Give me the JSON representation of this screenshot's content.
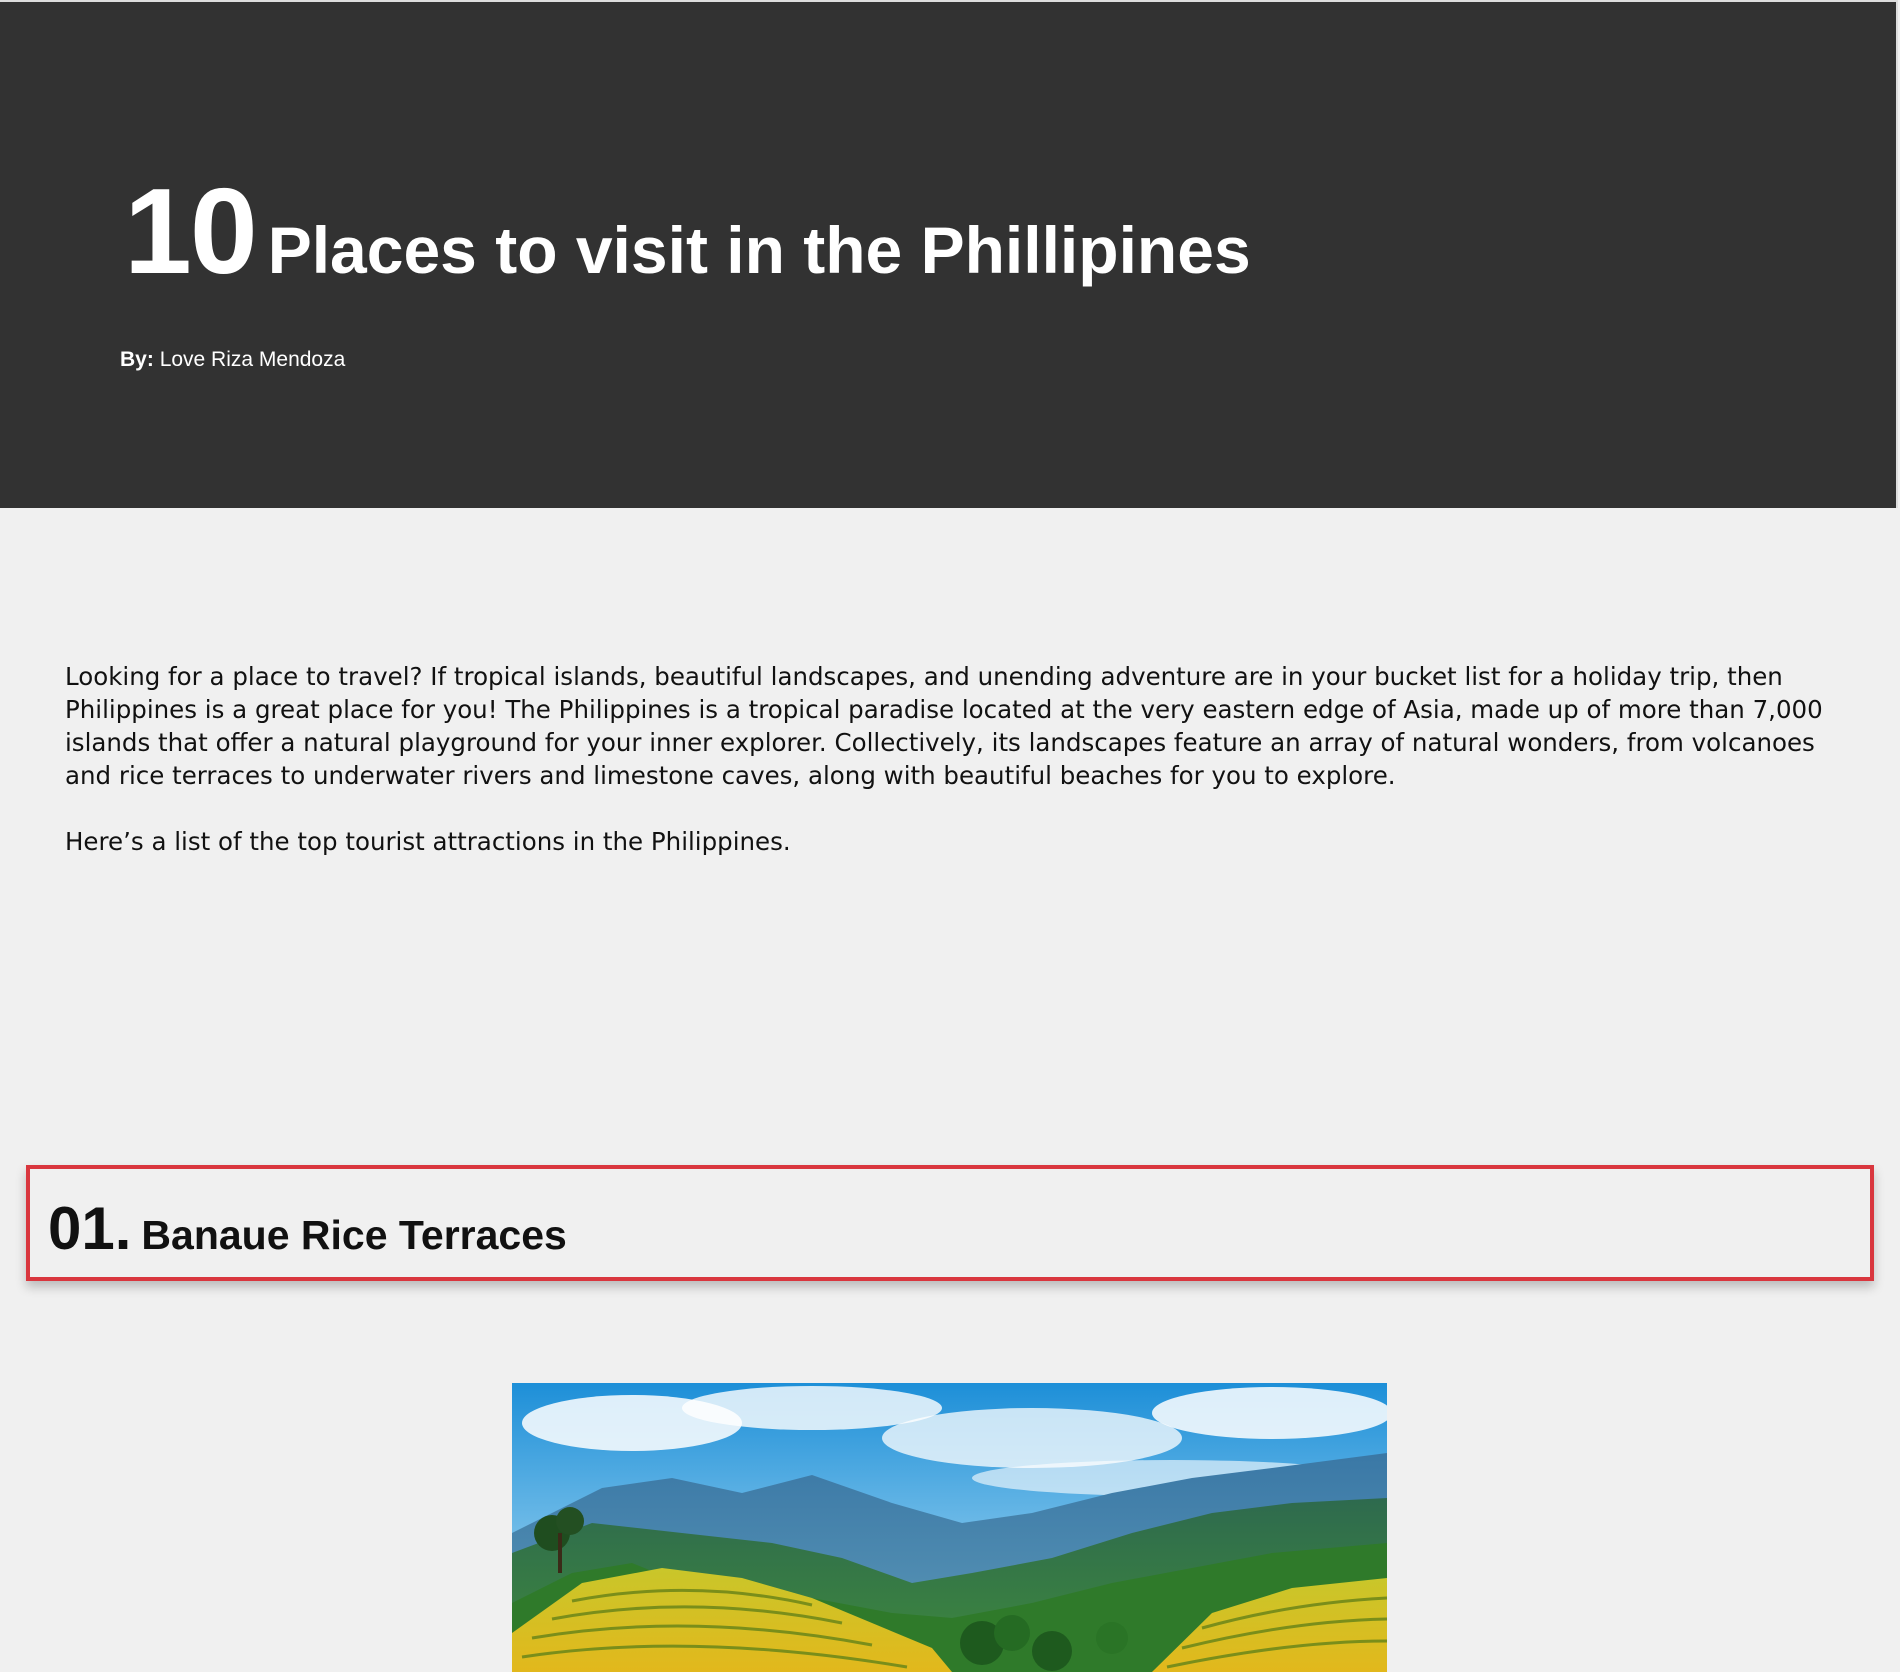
{
  "header": {
    "title_number": "10",
    "title_text": "Places to visit in the Phillipines",
    "byline_label": "By:",
    "byline_author": "Love Riza Mendoza"
  },
  "intro": {
    "paragraph_1": "Looking for a place to travel? If tropical islands, beautiful landscapes, and unending adventure are in your bucket list for a holiday trip, then Philippines is a great place for you! The Philippines is a tropical paradise located at the very eastern edge of Asia, made up of more than 7,000 islands that offer a natural playground for your inner explorer. Collectively, its landscapes feature an array of natural wonders, from volcanoes and rice terraces to underwater rivers and limestone caves, along with beautiful beaches for you to explore.",
    "paragraph_2": "Here’s a list of the top tourist attractions in the Philippines."
  },
  "section_1": {
    "number": "01.",
    "title": "Banaue Rice Terraces"
  },
  "colors": {
    "hero_background": "#323232",
    "page_background": "#f0f0f0",
    "section_border": "#d9363e"
  }
}
